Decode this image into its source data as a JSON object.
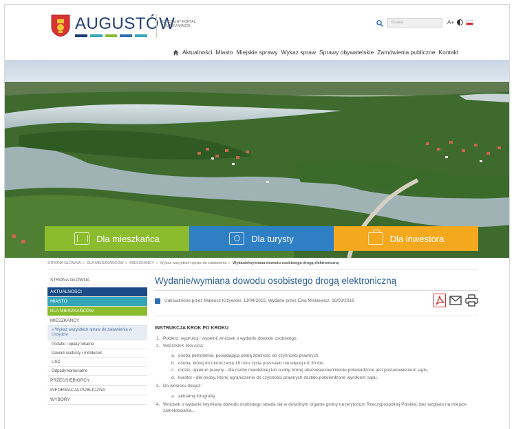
{
  "header": {
    "logo_text": "AUGUSTÓW",
    "logo_caption": "OFICJALNY PORTAL URZĘDU MIASTA",
    "logo_stripe_colors": [
      "#1f3f73",
      "#34a6b8",
      "#8bbc2d",
      "#2f6fb3",
      "#34a6b8"
    ],
    "search_placeholder": "Szukaj",
    "font_size_toggle": "A+",
    "contrast_icon": "contrast-icon",
    "language_flag": "polish-flag-icon"
  },
  "nav": {
    "home_icon": "home-icon",
    "items": [
      "Aktualności",
      "Miasto",
      "Miejskie sprawy",
      "Wykaz spraw",
      "Sprawy obywatelskie",
      "Zamówienia publiczne",
      "Kontakt"
    ]
  },
  "tiles": [
    {
      "label": "Dla mieszkańca",
      "color": "#8bbc2d",
      "icon": "building-icon"
    },
    {
      "label": "Dla turysty",
      "color": "#2f7fc4",
      "icon": "camera-icon"
    },
    {
      "label": "Dla inwestora",
      "color": "#f3a81e",
      "icon": "briefcase-icon"
    }
  ],
  "breadcrumb": [
    "STRONA GŁÓWNA",
    "DLA MIESZKAŃCÓW",
    "MIESZKAŃCY",
    "Wykaz wszystkich spraw do załatwienia",
    "Wydanie/wymiana dowodu osobistego drogą elektroniczną"
  ],
  "sidebar": [
    {
      "label": "STRONA GŁÓWNA",
      "style": "plain"
    },
    {
      "label": "AKTUALNOŚCI",
      "style": "blue"
    },
    {
      "label": "MIASTO",
      "style": "teal"
    },
    {
      "label": "DLA MIESZKAŃCÓW",
      "style": "green"
    },
    {
      "label": "MIESZKAŃCY",
      "style": "plain"
    },
    {
      "label": "» Wykaz wszystkich spraw do załatwienia w Urzędzie",
      "style": "active-sub"
    },
    {
      "label": "Podatki i opłaty lokalne",
      "style": "sub"
    },
    {
      "label": "Dowód osobisty i meldunek",
      "style": "sub"
    },
    {
      "label": "USC",
      "style": "sub"
    },
    {
      "label": "Odpady komunalne",
      "style": "sub"
    },
    {
      "label": "PRZEDSIĘBIORCY",
      "style": "plain"
    },
    {
      "label": "INFORMACJA PUBLICZNA",
      "style": "plain"
    },
    {
      "label": "WYBORY",
      "style": "plain"
    }
  ],
  "main": {
    "title": "Wydanie/wymiana dowodu osobistego drogą elektroniczną",
    "meta": "Uaktualnione przez Mateusz Krzywicki, 13/04/2016, Wydane przez Ewa Miśkiewicz, 16/03/2016",
    "meta_icons": [
      "pdf-icon",
      "mail-icon",
      "print-icon"
    ],
    "section_title": "INSTRUKCJA KROK PO KROKU",
    "step1": "Pobierz, wydrukuj i wypełnij wniosek o wydanie dowodu osobistego.",
    "step2": "WNIOSEK SKŁADA:",
    "step2_items": [
      "osoba pełnoletnia, posiadająca pełną zdolność do czynności prawnych,",
      "osoba, której do ukończenia 18 roku życia pozostało nie więcej niż 30 dni,",
      "rodzic, opiekun prawny - dla osoby małoletniej lub osoby, której ubezwłasnowolnienie potwierdzone jest postanowieniem sądu,",
      "kurator - dla osoby, której ograniczenie do czynności prawnych zostało potwierdzone wyrokiem sądu."
    ],
    "step3": "Do wniosku dołącz:",
    "step3_items": [
      "aktualną fotografię"
    ],
    "step4": "Wniosek o wydanie /wymianę dowodu osobistego składa się w dowolnym organie gminy na terytorium Rzeczypospolitej Polskiej, bez względu na miejsce zameldowania..."
  }
}
